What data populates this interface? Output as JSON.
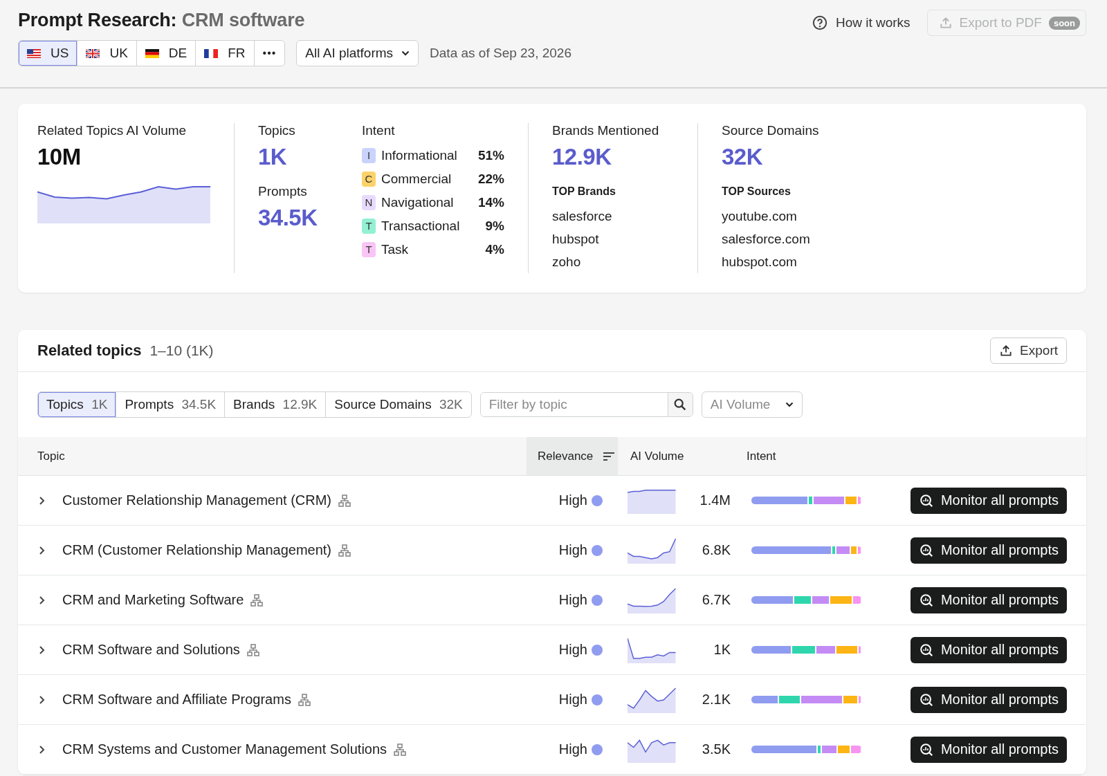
{
  "header": {
    "title": "Prompt Research:",
    "query": "CRM software",
    "help": "How it works",
    "export_pdf": {
      "label": "Export to PDF",
      "badge": "soon",
      "disabled": true
    },
    "countries": [
      {
        "label": "US",
        "kind": "us",
        "selected": true
      },
      {
        "label": "UK",
        "kind": "uk",
        "selected": false
      },
      {
        "label": "DE",
        "kind": "de",
        "selected": false
      },
      {
        "label": "FR",
        "kind": "fr",
        "selected": false
      }
    ],
    "more": "•••",
    "platform": "All AI platforms",
    "data_date": "Data as of Sep 23, 2026"
  },
  "summary": {
    "volume": {
      "label": "Related Topics AI Volume",
      "value": "10M"
    },
    "topics": {
      "label": "Topics",
      "value": "1K"
    },
    "prompts": {
      "label": "Prompts",
      "value": "34.5K"
    },
    "intent": {
      "label": "Intent",
      "items": [
        {
          "letter": "I",
          "name": "Informational",
          "share": "51%",
          "color": "#c9d3fb"
        },
        {
          "letter": "C",
          "name": "Commercial",
          "share": "22%",
          "color": "#fcd36a"
        },
        {
          "letter": "N",
          "name": "Navigational",
          "share": "14%",
          "color": "#e8dafd"
        },
        {
          "letter": "T",
          "name": "Transactional",
          "share": "9%",
          "color": "#92f0d4"
        },
        {
          "letter": "T",
          "name": "Task",
          "share": "4%",
          "color": "#f8c5f5"
        }
      ]
    },
    "brands": {
      "label": "Brands Mentioned",
      "value": "12.9K",
      "top_label": "TOP Brands",
      "top": [
        "salesforce",
        "hubspot",
        "zoho"
      ]
    },
    "sources": {
      "label": "Source Domains",
      "value": "32K",
      "top_label": "TOP Sources",
      "top": [
        "youtube.com",
        "salesforce.com",
        "hubspot.com"
      ]
    }
  },
  "related": {
    "title": "Related topics",
    "range": "1–10 (1K)",
    "export": "Export",
    "tabs": [
      {
        "label": "Topics",
        "count": "1K",
        "selected": true
      },
      {
        "label": "Prompts",
        "count": "34.5K",
        "selected": false
      },
      {
        "label": "Brands",
        "count": "12.9K",
        "selected": false
      },
      {
        "label": "Source Domains",
        "count": "32K",
        "selected": false
      }
    ],
    "filter": {
      "placeholder": "Filter by topic"
    },
    "sort_select": {
      "placeholder": "AI Volume"
    },
    "columns": [
      {
        "label": "Topic",
        "sorted": false
      },
      {
        "label": "Relevance",
        "sorted": true
      },
      {
        "label": "AI Volume",
        "sorted": false
      },
      {
        "label": "Intent",
        "sorted": false
      }
    ],
    "rows": [
      {
        "topic": "Customer Relationship Management (CRM)",
        "expanded": false,
        "relevance": "High",
        "volume": "1.4M",
        "action": "Monitor all prompts"
      },
      {
        "topic": "CRM (Customer Relationship Management)",
        "expanded": false,
        "relevance": "High",
        "volume": "6.8K",
        "action": "Monitor all prompts"
      },
      {
        "topic": "CRM and Marketing Software",
        "expanded": false,
        "relevance": "High",
        "volume": "6.7K",
        "action": "Monitor all prompts"
      },
      {
        "topic": "CRM Software and Solutions",
        "expanded": false,
        "relevance": "High",
        "volume": "1K",
        "action": "Monitor all prompts"
      },
      {
        "topic": "CRM Software and Affiliate Programs",
        "expanded": false,
        "relevance": "High",
        "volume": "2.1K",
        "action": "Monitor all prompts"
      },
      {
        "topic": "CRM Systems and Customer Management Solutions",
        "expanded": false,
        "relevance": "High",
        "volume": "3.5K",
        "action": "Monitor all prompts"
      }
    ]
  }
}
